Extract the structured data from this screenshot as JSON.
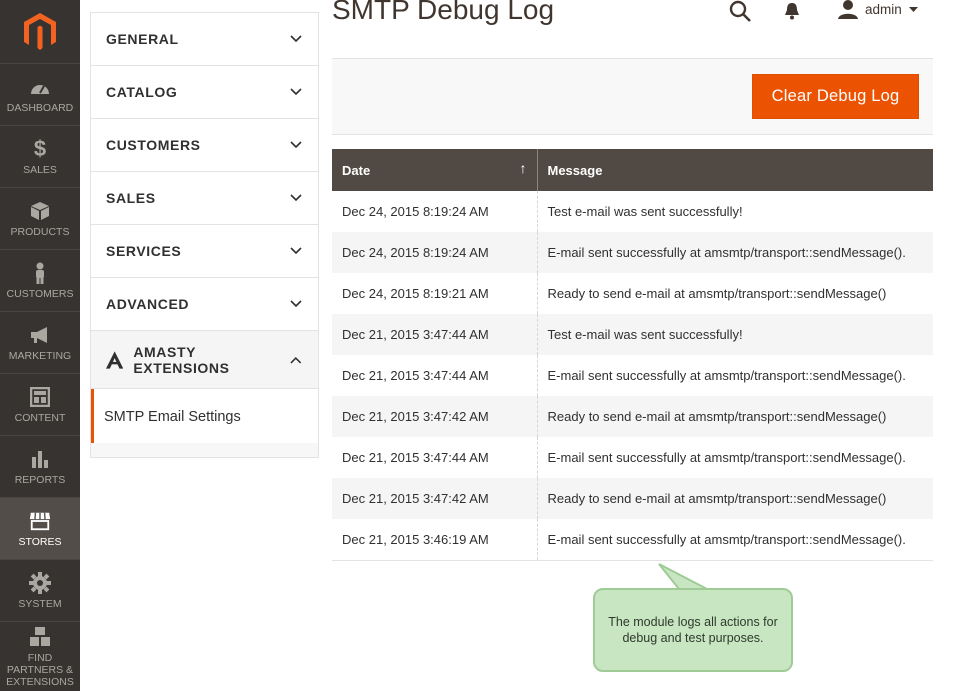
{
  "nav": {
    "items": [
      {
        "label": "DASHBOARD",
        "icon": "dashboard-icon"
      },
      {
        "label": "SALES",
        "icon": "dollar-icon"
      },
      {
        "label": "PRODUCTS",
        "icon": "cube-icon"
      },
      {
        "label": "CUSTOMERS",
        "icon": "person-icon"
      },
      {
        "label": "MARKETING",
        "icon": "megaphone-icon"
      },
      {
        "label": "CONTENT",
        "icon": "layout-icon"
      },
      {
        "label": "REPORTS",
        "icon": "bar-chart-icon"
      },
      {
        "label": "STORES",
        "icon": "store-icon"
      },
      {
        "label": "SYSTEM",
        "icon": "gear-icon"
      },
      {
        "label": "FIND PARTNERS & EXTENSIONS",
        "icon": "boxes-icon"
      }
    ],
    "active": "STORES"
  },
  "header": {
    "title": "SMTP Debug Log",
    "user": "admin"
  },
  "config_tabs": {
    "sections": [
      "GENERAL",
      "CATALOG",
      "CUSTOMERS",
      "SALES",
      "SERVICES",
      "ADVANCED"
    ],
    "amasty": "AMASTY EXTENSIONS",
    "amasty_sub": "SMTP Email Settings"
  },
  "actions": {
    "clear_label": "Clear Debug Log"
  },
  "grid": {
    "columns": {
      "date": "Date",
      "message": "Message"
    },
    "rows": [
      {
        "date": "Dec 24, 2015 8:19:24 AM",
        "message": "Test e-mail was sent successfully!"
      },
      {
        "date": "Dec 24, 2015 8:19:24 AM",
        "message": "E-mail sent successfully at amsmtp/transport::sendMessage()."
      },
      {
        "date": "Dec 24, 2015 8:19:21 AM",
        "message": "Ready to send e-mail at amsmtp/transport::sendMessage()"
      },
      {
        "date": "Dec 21, 2015 3:47:44 AM",
        "message": "Test e-mail was sent successfully!"
      },
      {
        "date": "Dec 21, 2015 3:47:44 AM",
        "message": "E-mail sent successfully at amsmtp/transport::sendMessage()."
      },
      {
        "date": "Dec 21, 2015 3:47:42 AM",
        "message": "Ready to send e-mail at amsmtp/transport::sendMessage()"
      },
      {
        "date": "Dec 21, 2015 3:47:44 AM",
        "message": "E-mail sent successfully at amsmtp/transport::sendMessage()."
      },
      {
        "date": "Dec 21, 2015 3:47:42 AM",
        "message": "Ready to send e-mail at amsmtp/transport::sendMessage()"
      },
      {
        "date": "Dec 21, 2015 3:46:19 AM",
        "message": "E-mail sent successfully at amsmtp/transport::sendMessage()."
      }
    ]
  },
  "callout": {
    "text": "The module logs all actions for debug and test purposes."
  },
  "colors": {
    "accent": "#eb5202",
    "nav_bg": "#373330",
    "grid_header": "#514943",
    "callout_bg": "#c9e6c3"
  }
}
